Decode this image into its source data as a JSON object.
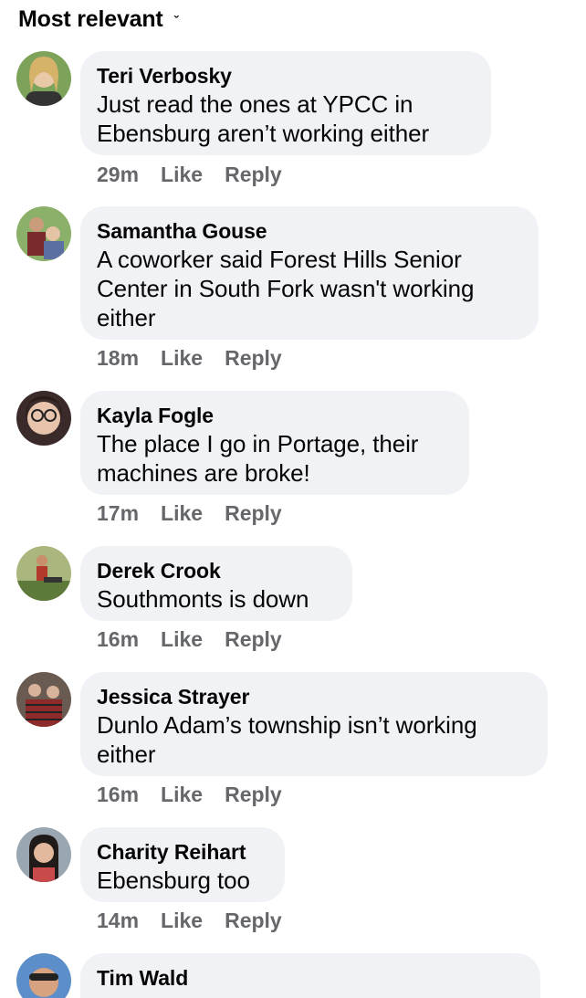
{
  "sort": {
    "label": "Most relevant"
  },
  "comments": [
    {
      "author": "Teri Verbosky",
      "text": [
        "Just read the ones at YPCC in",
        "Ebensburg aren’t working either"
      ],
      "time": "29m",
      "like": "Like",
      "reply": "Reply"
    },
    {
      "author": "Samantha Gouse",
      "text": [
        "A coworker said Forest Hills Senior",
        "Center in South Fork wasn't working",
        "either"
      ],
      "time": "18m",
      "like": "Like",
      "reply": "Reply"
    },
    {
      "author": "Kayla Fogle",
      "text": [
        "The place I go in Portage, their",
        "machines are broke!"
      ],
      "time": "17m",
      "like": "Like",
      "reply": "Reply"
    },
    {
      "author": "Derek Crook",
      "text": [
        "Southmonts is down"
      ],
      "time": "16m",
      "like": "Like",
      "reply": "Reply"
    },
    {
      "author": "Jessica Strayer",
      "text": [
        "Dunlo Adam’s township isn’t working",
        "either"
      ],
      "time": "16m",
      "like": "Like",
      "reply": "Reply"
    },
    {
      "author": "Charity Reihart",
      "text": [
        "Ebensburg too"
      ],
      "time": "14m",
      "like": "Like",
      "reply": "Reply"
    },
    {
      "author": "Tim Wald",
      "text": [],
      "time": "",
      "like": "",
      "reply": ""
    }
  ]
}
